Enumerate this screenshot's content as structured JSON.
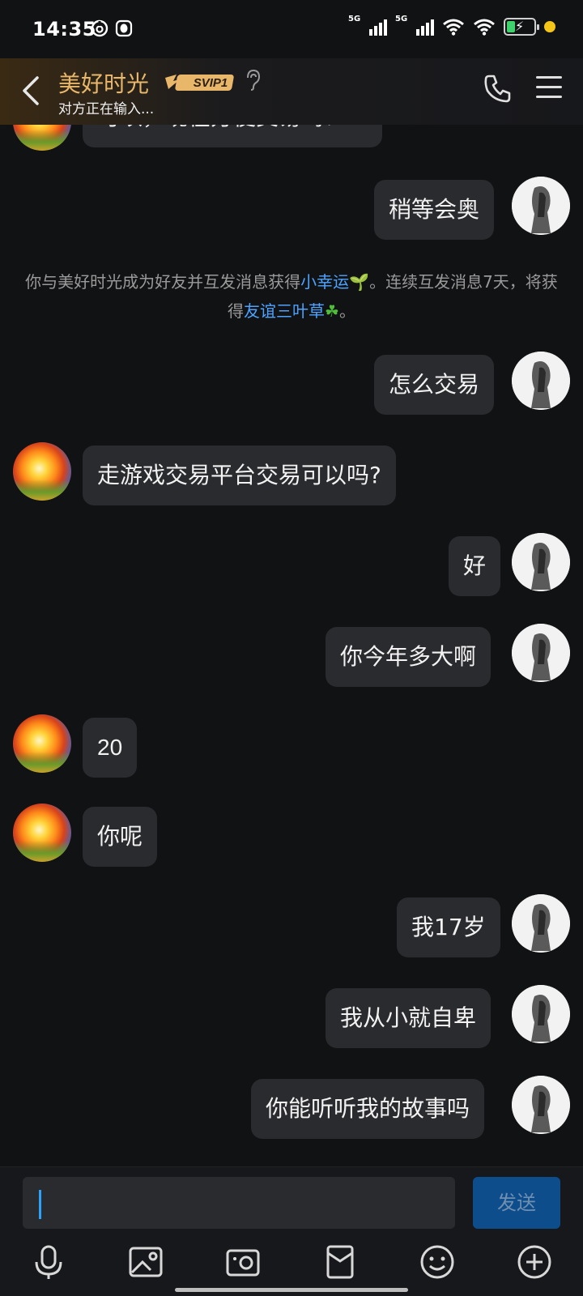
{
  "status_bar": {
    "time": "14:35",
    "network_1": "5G",
    "network_2": "5G"
  },
  "header": {
    "contact_name": "美好时光",
    "badge": "SVIP1",
    "typing_status": "对方正在输入..."
  },
  "messages": [
    {
      "side": "left",
      "text": "可以，现在方便交易吗？"
    },
    {
      "side": "right",
      "text": "稍等会奥"
    },
    {
      "side": "right",
      "text": "怎么交易"
    },
    {
      "side": "left",
      "text": "走游戏交易平台交易可以吗?"
    },
    {
      "side": "right",
      "text": "好"
    },
    {
      "side": "right",
      "text": "你今年多大啊"
    },
    {
      "side": "left",
      "text": "20"
    },
    {
      "side": "left",
      "text": "你呢"
    },
    {
      "side": "right",
      "text": "我17岁"
    },
    {
      "side": "right",
      "text": "我从小就自卑"
    },
    {
      "side": "right",
      "text": "你能听听我的故事吗"
    }
  ],
  "system_message": {
    "part1": "你与美好时光成为好友并互发消息获得",
    "link1": "小幸运",
    "part2": "。连续互发消息7天，将获得",
    "link2": "友谊三叶草",
    "part3": "。"
  },
  "input": {
    "value": "",
    "send_label": "发送"
  },
  "toolbar": {
    "icons": [
      "microphone-icon",
      "image-icon",
      "camera-icon",
      "red-packet-icon",
      "emoji-icon",
      "plus-icon"
    ]
  },
  "colors": {
    "background": "#111214",
    "bubble": "#2a2b2e",
    "contact_name": "#e8b76a",
    "link": "#4ea3ff",
    "send_button": "#0e4d8c"
  }
}
